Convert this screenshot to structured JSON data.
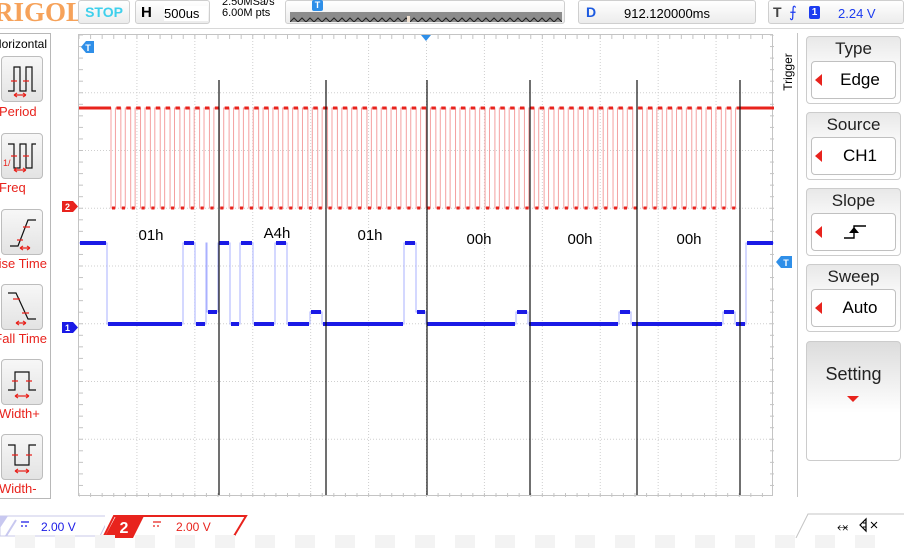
{
  "brand": "RIGOL",
  "status": "STOP",
  "horizontal": {
    "label": "H",
    "timebase": "500us"
  },
  "acquisition": {
    "sample_rate": "2.50MSa/s",
    "memory_depth": "6.00M pts"
  },
  "delay": {
    "label": "D",
    "value": "912.120000ms"
  },
  "trigger_status": {
    "label": "T",
    "slope_icon": "rising-edge-icon",
    "source_channel": "1",
    "level": "2.24 V"
  },
  "measure_menu": {
    "title": "Horizontal",
    "items": [
      {
        "label": "Period",
        "icon": "period-icon"
      },
      {
        "label": "Freq",
        "icon": "frequency-icon"
      },
      {
        "label": "Rise Time",
        "icon": "rise-time-icon"
      },
      {
        "label": "Fall Time",
        "icon": "fall-time-icon"
      },
      {
        "label": "+Width",
        "icon": "positive-width-icon"
      },
      {
        "label": "-Width",
        "icon": "negative-width-icon"
      }
    ]
  },
  "trigger_menu": {
    "tab_label": "Trigger",
    "groups": [
      {
        "title": "Type",
        "value": "Edge"
      },
      {
        "title": "Source",
        "value": "CH1"
      },
      {
        "title": "Slope",
        "value": "rising-edge-icon"
      },
      {
        "title": "Sweep",
        "value": "Auto"
      }
    ],
    "setting_label": "Setting"
  },
  "channels": [
    {
      "id": "1",
      "coupling": "DC",
      "scale": "2.00 V",
      "color": "#1a1ae6"
    },
    {
      "id": "2",
      "coupling": "DC",
      "scale": "2.00 V",
      "color": "#e8231d"
    }
  ],
  "markers": {
    "trigger_position": "T",
    "trigger_level": "T",
    "ch1": "1",
    "ch2": "2"
  },
  "decode": {
    "bytes": [
      "01h",
      "A4h",
      "01h",
      "00h",
      "00h",
      "00h"
    ]
  },
  "status_icons": [
    "usb-icon",
    "speaker-muted-icon"
  ],
  "colors": {
    "ch1": "#1a1ae6",
    "ch2": "#e8231d",
    "trigger": "#2f8fe8",
    "accent": "#e8231d",
    "logo": "#f6a25a",
    "stop": "#3fd0ec"
  }
}
